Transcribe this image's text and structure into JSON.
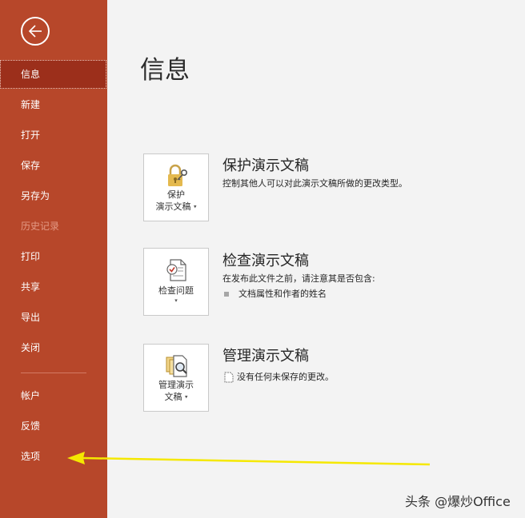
{
  "sidebar": {
    "items": [
      {
        "label": "信息"
      },
      {
        "label": "新建"
      },
      {
        "label": "打开"
      },
      {
        "label": "保存"
      },
      {
        "label": "另存为"
      },
      {
        "label": "历史记录"
      },
      {
        "label": "打印"
      },
      {
        "label": "共享"
      },
      {
        "label": "导出"
      },
      {
        "label": "关闭"
      },
      {
        "label": "帐户"
      },
      {
        "label": "反馈"
      },
      {
        "label": "选项"
      }
    ]
  },
  "main": {
    "title": "信息",
    "sections": [
      {
        "button_line1": "保护",
        "button_line2": "演示文稿",
        "title": "保护演示文稿",
        "desc": "控制其他人可以对此演示文稿所做的更改类型。"
      },
      {
        "button_line1": "检查问题",
        "title": "检查演示文稿",
        "desc": "在发布此文件之前，请注意其是否包含:",
        "bullet": "文档属性和作者的姓名"
      },
      {
        "button_line1": "管理演示",
        "button_line2": "文稿",
        "title": "管理演示文稿",
        "desc": "没有任何未保存的更改。"
      }
    ]
  },
  "watermark": "头条 @爆炒Office",
  "colors": {
    "sidebar_bg": "#b7472a",
    "sidebar_active": "#9c2f1b",
    "arrow": "#f5e800"
  }
}
